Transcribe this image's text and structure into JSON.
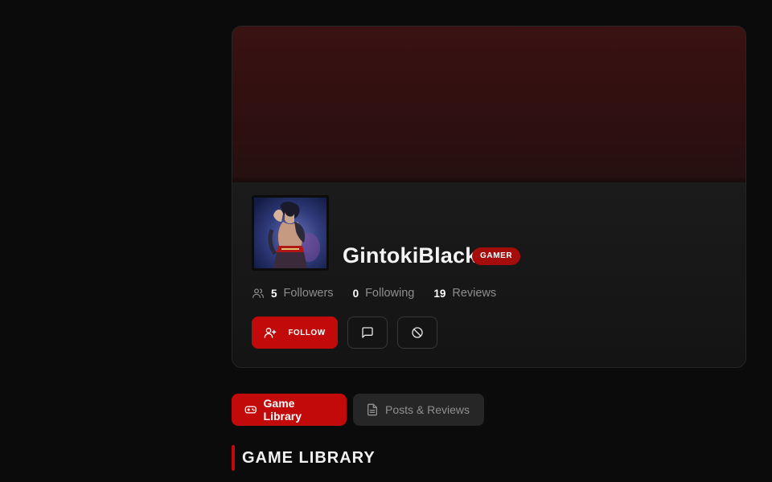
{
  "profile": {
    "username": "GintokiBlack",
    "badge": "GAMER",
    "avatar_icon": "character-portrait",
    "stats": [
      {
        "value": "5",
        "label": "Followers"
      },
      {
        "value": "0",
        "label": "Following"
      },
      {
        "value": "19",
        "label": "Reviews"
      }
    ],
    "actions": {
      "follow_label": "FOLLOW",
      "follow_icon": "user-plus-icon",
      "message_icon": "message-square-icon",
      "block_icon": "ban-icon"
    }
  },
  "tabs": [
    {
      "label": "Game Library",
      "icon": "gamepad-icon",
      "active": true
    },
    {
      "label": "Posts & Reviews",
      "icon": "document-icon",
      "active": false
    }
  ],
  "section": {
    "title": "GAME LIBRARY"
  },
  "colors": {
    "accent": "#c30a0a",
    "badge": "#a50d0d",
    "background": "#0b0b0b",
    "card": "#151515",
    "banner": "#3a1212"
  }
}
